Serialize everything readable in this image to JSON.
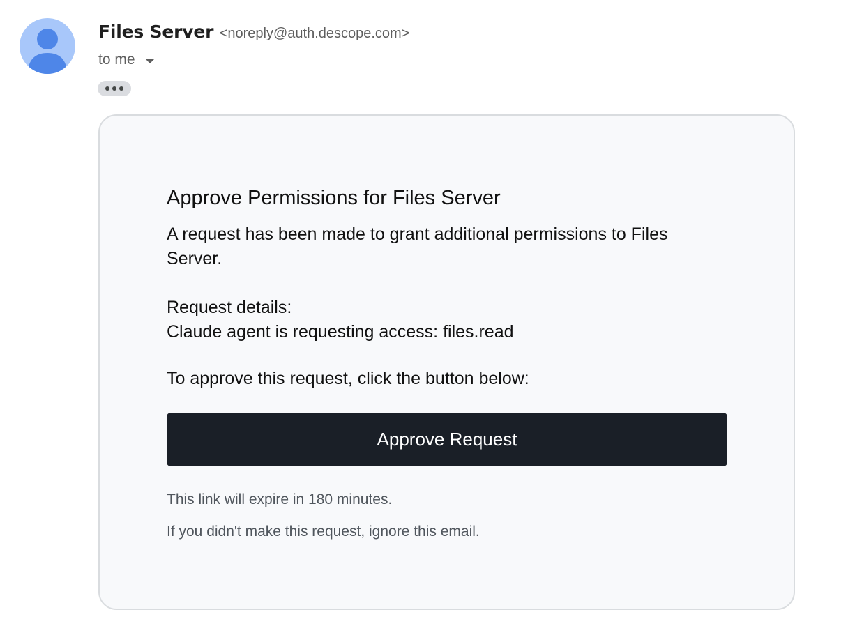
{
  "sender": {
    "name": "Files Server",
    "email": "<noreply@auth.descope.com>",
    "avatar_icon": "person-avatar-icon",
    "avatar_bg_color": "#a8c7fa",
    "avatar_fg_color": "#4285f4"
  },
  "recipient": {
    "label": "to me",
    "dropdown_icon": "caret-down-icon"
  },
  "more_button": {
    "icon": "more-horizontal-icon"
  },
  "email_body": {
    "title": "Approve Permissions for Files Server",
    "intro": "A request has been made to grant additional permissions to Files Server.",
    "details_heading": "Request details:",
    "details_value": "Claude agent is requesting access: files.read",
    "instruction": "To approve this request, click the button below:",
    "approve_button_label": "Approve Request",
    "expiry_note": "This link will expire in 180 minutes.",
    "ignore_note": "If you didn't make this request, ignore this email."
  },
  "colors": {
    "button_bg": "#1a1f27",
    "card_bg": "#f8f9fb",
    "card_border": "#d9dcdf"
  }
}
